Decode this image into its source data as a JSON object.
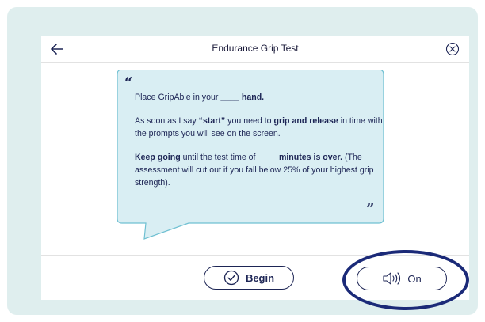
{
  "header": {
    "title": "Endurance Grip Test",
    "back_icon": "arrow-left-icon",
    "close_icon": "close-circle-icon"
  },
  "instructions": {
    "line1_prefix": "Place GripAble in your ",
    "line1_blank": "____",
    "line1_suffix": " hand.",
    "line2_prefix": "As soon as I say ",
    "line2_start": "“start”",
    "line2_mid": " you need to ",
    "line2_action": "grip and release",
    "line2_suffix": " in time with the prompts you will see on the screen.",
    "line3_keep": "Keep going",
    "line3_mid": " until the test time of ",
    "line3_blank": "____ minutes is over.",
    "line3_rest": " (The assessment will cut out if you fall below 25% of your highest grip strength).",
    "open_quote": "“",
    "close_quote": "”"
  },
  "footer": {
    "begin_label": "Begin",
    "sound_label": "On"
  },
  "colors": {
    "navy": "#1d2555",
    "bubble_fill": "#d9eef3",
    "bubble_border": "#6fc0d2",
    "frame": "#dfeeee",
    "highlight": "#1b2a78"
  }
}
